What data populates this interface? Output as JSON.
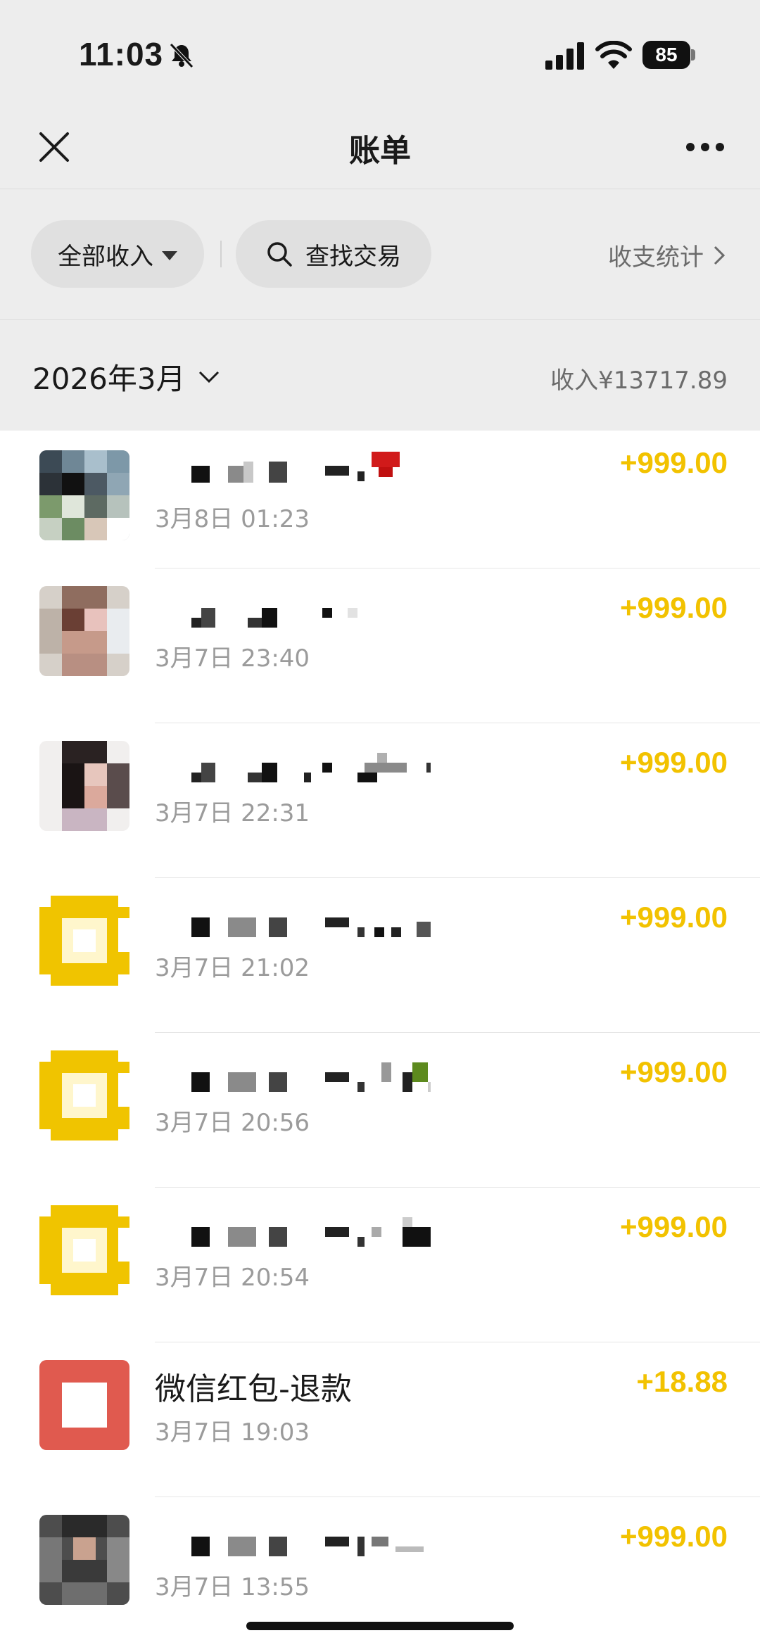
{
  "status_bar": {
    "time": "11:03",
    "battery": "85"
  },
  "nav": {
    "title": "账单"
  },
  "filters": {
    "all_label": "全部收入",
    "search_label": "查找交易",
    "stats_label": "收支统计"
  },
  "month": {
    "label": "2026年3月",
    "income_total": "收入¥13717.89"
  },
  "colors": {
    "amount": "#f2c200",
    "background_top": "#ededed",
    "red_packet": "#e05a4f",
    "yellow_icon": "#f0c400"
  },
  "transactions": [
    {
      "name": "",
      "date": "3月8日 01:23",
      "amount": "+999.00",
      "avatar": "photo-avatar"
    },
    {
      "name": "",
      "date": "3月7日 23:40",
      "amount": "+999.00",
      "avatar": "photo-avatar"
    },
    {
      "name": "",
      "date": "3月7日 22:31",
      "amount": "+999.00",
      "avatar": "photo-avatar"
    },
    {
      "name": "",
      "date": "3月7日 21:02",
      "amount": "+999.00",
      "avatar": "yellow-transfer-icon"
    },
    {
      "name": "",
      "date": "3月7日 20:56",
      "amount": "+999.00",
      "avatar": "yellow-transfer-icon"
    },
    {
      "name": "",
      "date": "3月7日 20:54",
      "amount": "+999.00",
      "avatar": "yellow-transfer-icon"
    },
    {
      "name": "微信红包-退款",
      "date": "3月7日 19:03",
      "amount": "+18.88",
      "avatar": "red-packet-icon"
    },
    {
      "name": "",
      "date": "3月7日 13:55",
      "amount": "+999.00",
      "avatar": "photo-avatar"
    }
  ]
}
